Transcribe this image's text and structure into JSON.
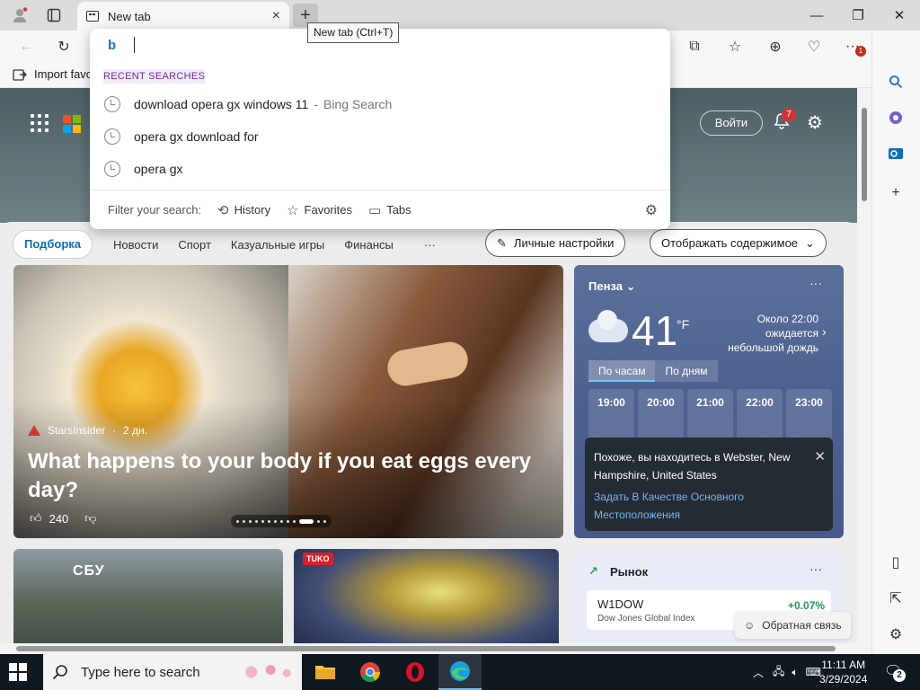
{
  "browser": {
    "tab": {
      "title": "New tab",
      "close_glyph": "×"
    },
    "newtab_glyph": "+",
    "tooltip": "New tab (Ctrl+T)",
    "window_controls": {
      "minimize": "—",
      "maximize": "❐",
      "close": "✕"
    },
    "toolbar": {
      "back": "←",
      "refresh": "↻",
      "split": "⧉",
      "favorites": "☆",
      "collections": "⊕",
      "heart": "♡",
      "more": "···",
      "badge": "1"
    },
    "favbar": {
      "import_label": "Import favo"
    }
  },
  "omnibox": {
    "engine_glyph": "b",
    "value": "",
    "recent_header": "RECENT SEARCHES",
    "suggestions": [
      {
        "text": "download opera gx windows 11",
        "suffix": "Bing Search"
      },
      {
        "text": "opera gx download for",
        "suffix": ""
      },
      {
        "text": "opera gx",
        "suffix": ""
      }
    ],
    "filter_label": "Filter your search:",
    "filters": [
      "History",
      "Favorites",
      "Tabs"
    ]
  },
  "newtab": {
    "signin": "Войти",
    "bell_count": "7",
    "nav": {
      "active": "Подборка",
      "items": [
        "Новости",
        "Спорт",
        "Казуальные игры",
        "Финансы"
      ],
      "more": "···",
      "personalize": "Личные настройки",
      "show_content": "Отображать содержимое"
    },
    "hero": {
      "source": "StarsInsider",
      "age": "2 дн.",
      "title": "What happens to your body if you eat eggs every day?",
      "likes": "240"
    },
    "weather": {
      "city": "Пенза",
      "temp": "41",
      "unit": "°F",
      "desc_line1": "Около 22:00",
      "desc_line2": "ожидается",
      "desc_line3": "небольшой дождь",
      "tabs": [
        "По часам",
        "По дням"
      ],
      "hours": [
        "19:00",
        "20:00",
        "21:00",
        "22:00",
        "23:00"
      ],
      "popup_msg": "Похоже, вы находитесь в Webster, New Hampshire, United States",
      "popup_link": "Задать В Качестве Основного Местоположения"
    },
    "card2_label": "СБУ",
    "card3_badge": "TUKO",
    "market": {
      "title": "Рынок",
      "symbol": "W1DOW",
      "name": "Dow Jones Global Index",
      "change": "+0.07%"
    },
    "feedback": "Обратная связь"
  },
  "taskbar": {
    "search_placeholder": "Type here to search",
    "time": "11:11 AM",
    "date": "3/29/2024",
    "notifications": "2"
  },
  "colors": {
    "accent": "#0f6cbd",
    "taskbar": "#101820",
    "weather_bg": "#4d6190"
  }
}
